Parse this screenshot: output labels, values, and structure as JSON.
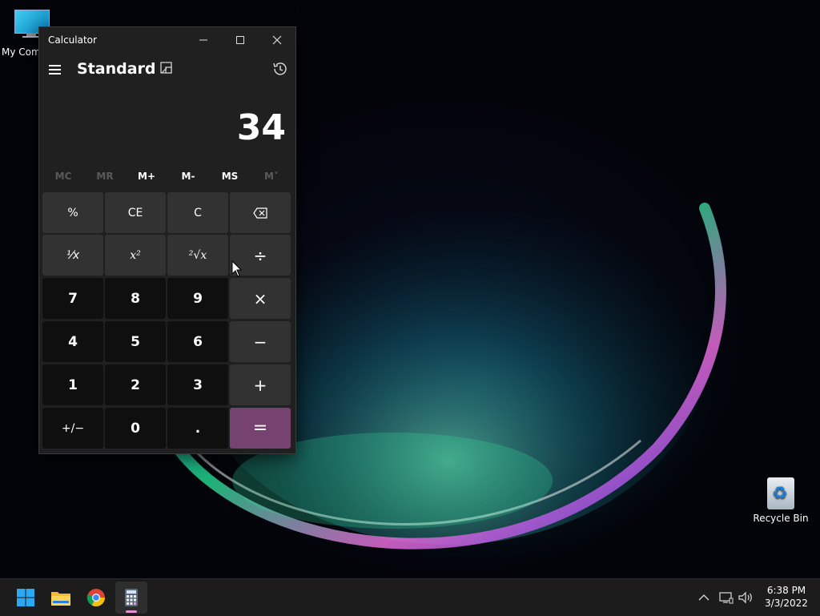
{
  "desktop": {
    "icons": [
      {
        "label": "My Com"
      },
      {
        "label": "Recycle Bin"
      }
    ]
  },
  "calculator": {
    "window_title": "Calculator",
    "mode": "Standard",
    "display_value": "34",
    "memory": [
      "MC",
      "MR",
      "M+",
      "M-",
      "MS",
      "M˅"
    ],
    "keys": {
      "percent": "%",
      "ce": "CE",
      "c": "C",
      "reciprocal": "⅟x",
      "square": "x²",
      "sqrt": "²√x",
      "divide": "÷",
      "seven": "7",
      "eight": "8",
      "nine": "9",
      "multiply": "×",
      "four": "4",
      "five": "5",
      "six": "6",
      "minus": "−",
      "one": "1",
      "two": "2",
      "three": "3",
      "plus": "+",
      "negate": "+/−",
      "zero": "0",
      "decimal": ".",
      "equals": "="
    },
    "accent_color": "#76426f"
  },
  "taskbar": {
    "apps": [
      "start-icon",
      "file-explorer-icon",
      "chrome-icon",
      "calculator-icon"
    ],
    "clock": {
      "time": "6:38 PM",
      "date": "3/3/2022"
    }
  }
}
